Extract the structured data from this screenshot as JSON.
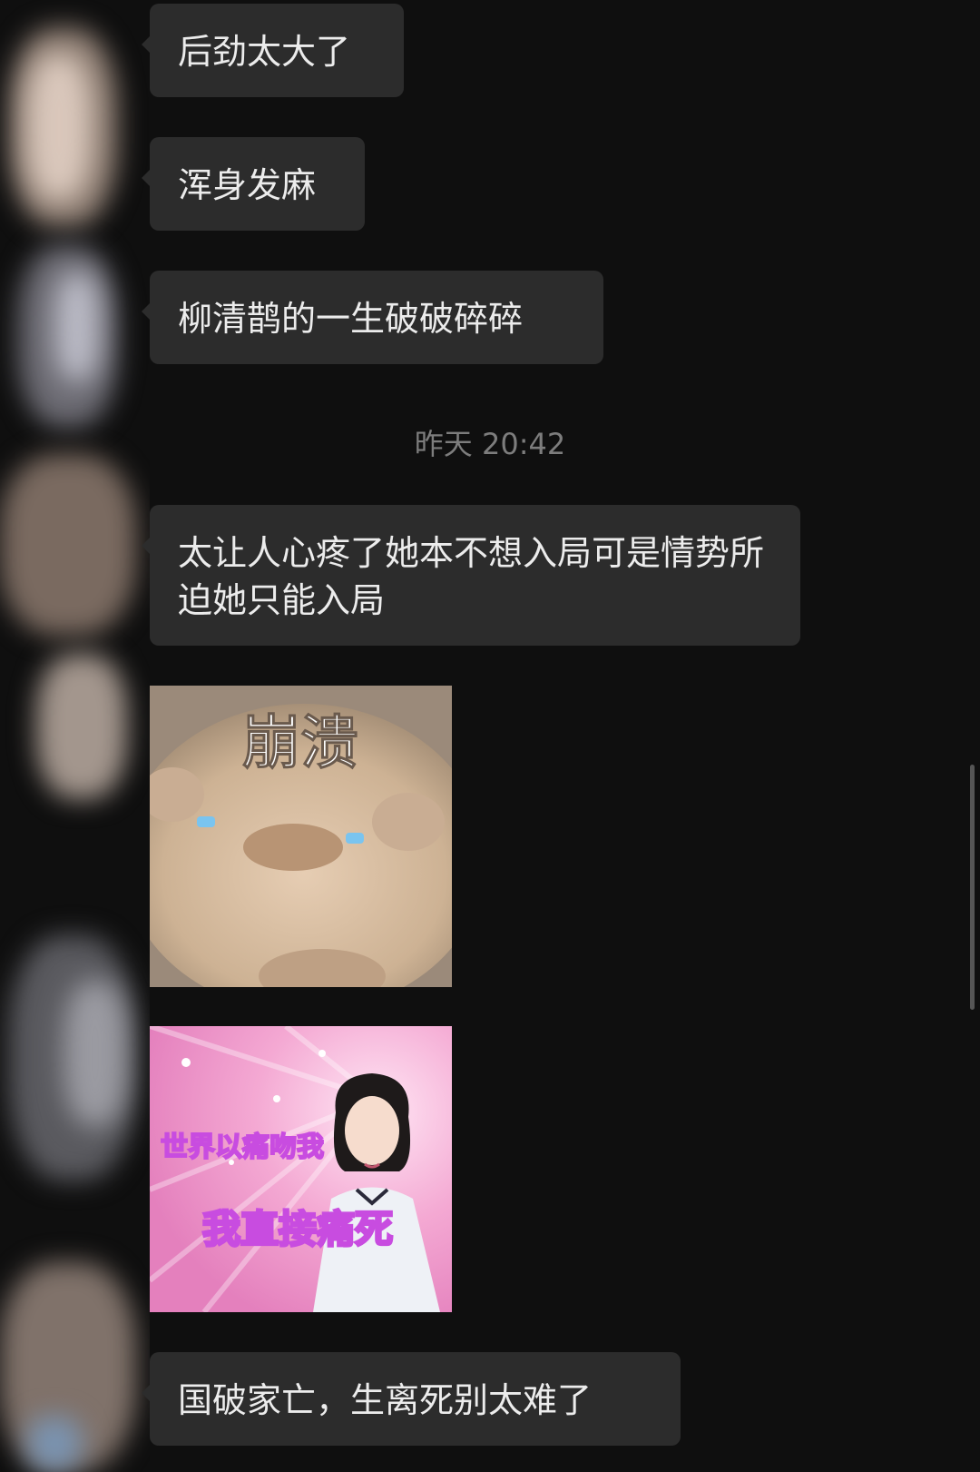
{
  "messages": [
    {
      "type": "text",
      "text": "后劲太大了"
    },
    {
      "type": "text",
      "text": "浑身发麻"
    },
    {
      "type": "text",
      "text": "柳清鹊的一生破破碎碎"
    },
    {
      "type": "timestamp",
      "text": "昨天 20:42"
    },
    {
      "type": "text",
      "text": "太让人心疼了她本不想入局可是情势所迫她只能入局"
    },
    {
      "type": "sticker",
      "caption": "崩溃",
      "icon": "crying-hamster-sticker"
    },
    {
      "type": "sticker",
      "caption_top": "世界以痛吻我",
      "caption_bottom": "我直接痛死",
      "icon": "girl-pink-sparkle-sticker"
    },
    {
      "type": "text",
      "text": "国破家亡，生离死别太难了"
    }
  ],
  "colors": {
    "background": "#0f0f0f",
    "bubble": "#2c2c2c",
    "bubble_text": "#ececec",
    "timestamp": "#7d7d7d",
    "sticker_pink": "#f4a9d3",
    "sticker_text_purple": "#c84ce0"
  }
}
